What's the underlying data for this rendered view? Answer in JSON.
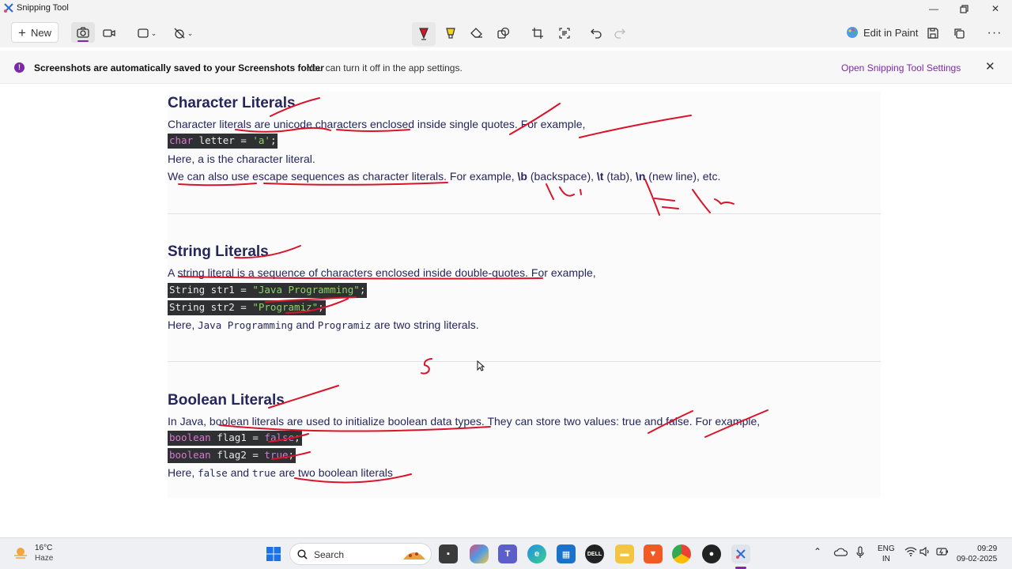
{
  "window": {
    "title": "Snipping Tool"
  },
  "toolbar": {
    "new_label": "New",
    "edit_in_paint_label": "Edit in Paint"
  },
  "notification": {
    "title": "Screenshots are automatically saved to your Screenshots folder",
    "message": "You can turn it off in the app settings.",
    "settings_link": "Open Snipping Tool Settings"
  },
  "content": {
    "character": {
      "heading": "Character Literals",
      "intro": "Character literals are unicode characters enclosed inside single quotes. For example,",
      "code_kw": "char",
      "code_rest": " letter = ",
      "code_str": "'a'",
      "code_end": ";",
      "line2": "Here, a is the character literal.",
      "line3_a": "We can also use escape sequences as character literals. For example, ",
      "esc_b": "\\b",
      "esc_b_desc": " (backspace), ",
      "esc_t": "\\t",
      "esc_t_desc": " (tab), ",
      "esc_n": "\\n",
      "esc_n_desc": " (new line), etc."
    },
    "string": {
      "heading": "String Literals",
      "intro": "A string literal is a sequence of characters enclosed inside double-quotes. For example,",
      "code1_a": "String str1 = ",
      "code1_str": "\"Java Programming\"",
      "code1_end": ";",
      "code2_a": "String str2 = ",
      "code2_str": "\"Programiz\"",
      "code2_end": ";",
      "outro_a": "Here, ",
      "outro_m1": "Java Programming",
      "outro_b": " and ",
      "outro_m2": "Programiz",
      "outro_c": " are two string literals."
    },
    "boolean": {
      "heading": "Boolean Literals",
      "intro": "In Java, boolean literals are used to initialize boolean data types. They can store two values: true and false. For example,",
      "code1_kw": "boolean",
      "code1_rest": " flag1 = ",
      "code1_val": "false",
      "code1_end": ";",
      "code2_kw": "boolean",
      "code2_rest": " flag2 = ",
      "code2_val": "true",
      "code2_end": ";",
      "outro_a": "Here, ",
      "outro_m1": "false",
      "outro_b": " and ",
      "outro_m2": "true",
      "outro_c": " are two boolean literals"
    }
  },
  "taskbar": {
    "weather_temp": "16°C",
    "weather_desc": "Haze",
    "search_label": "Search",
    "lang_1": "ENG",
    "lang_2": "IN",
    "time": "09:29",
    "date": "09-02-2025"
  },
  "colors": {
    "accent": "#7a2aa6",
    "ink": "#d8142a",
    "heading": "#25265e"
  }
}
